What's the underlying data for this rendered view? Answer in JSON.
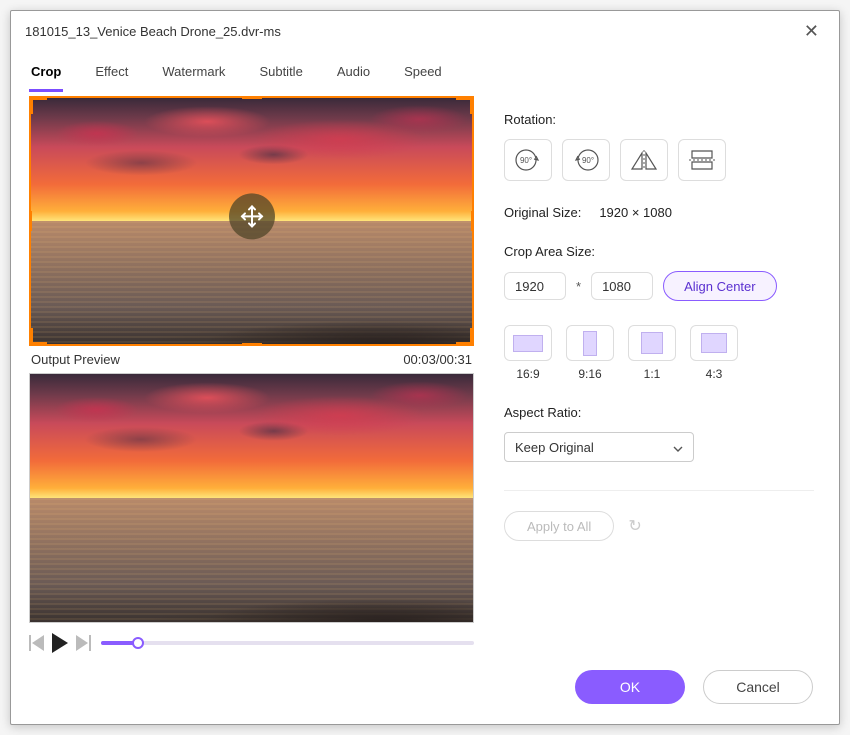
{
  "window": {
    "title": "181015_13_Venice Beach Drone_25.dvr-ms"
  },
  "tabs": {
    "items": [
      {
        "label": "Crop",
        "active": true
      },
      {
        "label": "Effect"
      },
      {
        "label": "Watermark"
      },
      {
        "label": "Subtitle"
      },
      {
        "label": "Audio"
      },
      {
        "label": "Speed"
      }
    ]
  },
  "preview": {
    "output_label": "Output Preview",
    "timecode": "00:03/00:31"
  },
  "panel": {
    "rotation_label": "Rotation:",
    "original_size_label": "Original Size:",
    "original_size_value": "1920 × 1080",
    "crop_area_label": "Crop Area Size:",
    "crop_w": "1920",
    "crop_mult": "*",
    "crop_h": "1080",
    "align_center": "Align Center",
    "ratios": {
      "r169": "16:9",
      "r916": "9:16",
      "r11": "1:1",
      "r43": "4:3"
    },
    "aspect_label": "Aspect Ratio:",
    "aspect_value": "Keep Original",
    "apply_all": "Apply to All"
  },
  "footer": {
    "ok": "OK",
    "cancel": "Cancel"
  }
}
